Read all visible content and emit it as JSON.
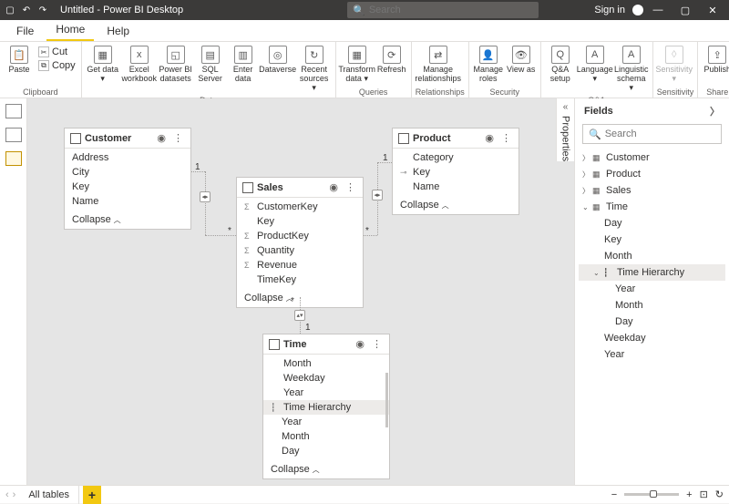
{
  "title": "Untitled - Power BI Desktop",
  "search_placeholder": "Search",
  "sign_in": "Sign in",
  "menus": {
    "file": "File",
    "home": "Home",
    "help": "Help"
  },
  "ribbon": {
    "clipboard": {
      "paste": "Paste",
      "cut": "Cut",
      "copy": "Copy",
      "label": "Clipboard"
    },
    "data": {
      "get": "Get data ▾",
      "excel": "Excel workbook",
      "pbi": "Power BI datasets",
      "sql": "SQL Server",
      "enter": "Enter data",
      "dataverse": "Dataverse",
      "recent": "Recent sources ▾",
      "label": "Data"
    },
    "queries": {
      "transform": "Transform data ▾",
      "refresh": "Refresh",
      "label": "Queries"
    },
    "rel": {
      "manage": "Manage relationships",
      "label": "Relationships"
    },
    "security": {
      "roles": "Manage roles",
      "view": "View as",
      "label": "Security"
    },
    "qa": {
      "setup": "Q&A setup",
      "lang": "Language ▾",
      "schema": "Linguistic schema ▾",
      "label": "Q&A"
    },
    "sens": {
      "sens": "Sensitivity ▾",
      "label": "Sensitivity"
    },
    "share": {
      "publish": "Publish",
      "label": "Share"
    }
  },
  "entities": {
    "customer": {
      "name": "Customer",
      "fields": [
        "Address",
        "City",
        "Key",
        "Name"
      ],
      "collapse": "Collapse"
    },
    "sales": {
      "name": "Sales",
      "fields": [
        "CustomerKey",
        "Key",
        "ProductKey",
        "Quantity",
        "Revenue",
        "TimeKey"
      ],
      "icons": [
        "Σ",
        "",
        "Σ",
        "Σ",
        "Σ",
        ""
      ],
      "collapse": "Collapse"
    },
    "product": {
      "name": "Product",
      "fields": [
        "Category",
        "Key",
        "Name"
      ],
      "icons": [
        "",
        "⊸",
        ""
      ],
      "collapse": "Collapse"
    },
    "time": {
      "name": "Time",
      "fields": [
        "Month",
        "Weekday",
        "Year",
        "Time Hierarchy",
        "Year",
        "Month",
        "Day"
      ],
      "collapse": "Collapse"
    }
  },
  "rel_labels": {
    "one": "1",
    "many": "*"
  },
  "fields_panel": {
    "title": "Fields",
    "search": "Search",
    "tables": {
      "customer": "Customer",
      "product": "Product",
      "sales": "Sales",
      "time": "Time",
      "time_fields": [
        "Day",
        "Key",
        "Month"
      ],
      "hierarchy": "Time Hierarchy",
      "hier_fields": [
        "Year",
        "Month",
        "Day"
      ],
      "time_rest": [
        "Weekday",
        "Year"
      ]
    }
  },
  "properties_label": "Properties",
  "status": {
    "all_tables": "All tables"
  }
}
